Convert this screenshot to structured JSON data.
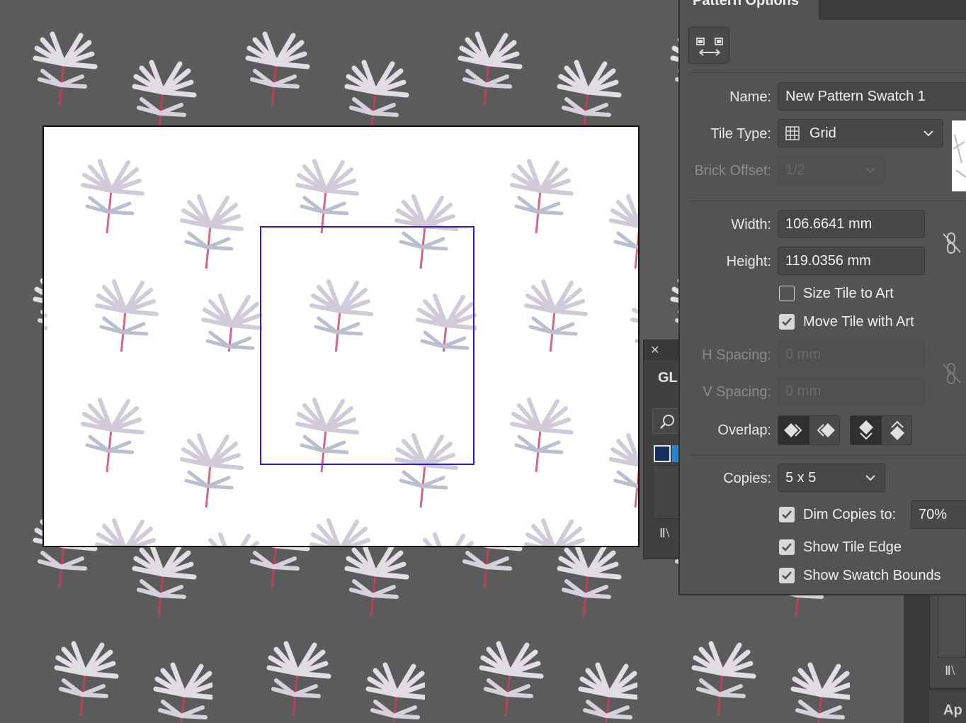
{
  "app": {
    "panel_title": "Pattern Options",
    "gl_panel_title": "GL",
    "app_tab_label": "Ap"
  },
  "pattern_options": {
    "name_label": "Name:",
    "name_value": "New Pattern Swatch 1",
    "tile_type_label": "Tile Type:",
    "tile_type_value": "Grid",
    "brick_offset_label": "Brick Offset:",
    "brick_offset_value": "1/2",
    "width_label": "Width:",
    "width_value": "106.6641 mm",
    "height_label": "Height:",
    "height_value": "119.0356 mm",
    "size_tile_to_art": {
      "label": "Size Tile to Art",
      "checked": false
    },
    "move_tile_with_art": {
      "label": "Move Tile with Art",
      "checked": true
    },
    "h_spacing_label": "H Spacing:",
    "h_spacing_value": "0 mm",
    "v_spacing_label": "V Spacing:",
    "v_spacing_value": "0 mm",
    "overlap_label": "Overlap:",
    "overlap_selected": {
      "horizontal": "left-in-front",
      "vertical": "top-in-front"
    },
    "copies_label": "Copies:",
    "copies_value": "5 x 5",
    "dim_copies": {
      "label": "Dim Copies to:",
      "checked": true,
      "value": "70%"
    },
    "show_tile_edge": {
      "label": "Show Tile Edge",
      "checked": true
    },
    "show_swatch_bounds": {
      "label": "Show Swatch Bounds",
      "checked": true
    }
  },
  "icons": {
    "edit_tile": "edit-pattern-tile-icon",
    "grid": "grid-icon",
    "link": "link-broken-icon",
    "search": "search-icon",
    "close": "close-icon",
    "libraries": "libraries-icon"
  },
  "colors": {
    "canvas_bg": "#5b5b5b",
    "panel_bg": "#535353",
    "tile_edge": "#2a1ad8",
    "gl_fill_swatch": "#14305e",
    "gl_stroke_swatch": "#1e88d0"
  }
}
